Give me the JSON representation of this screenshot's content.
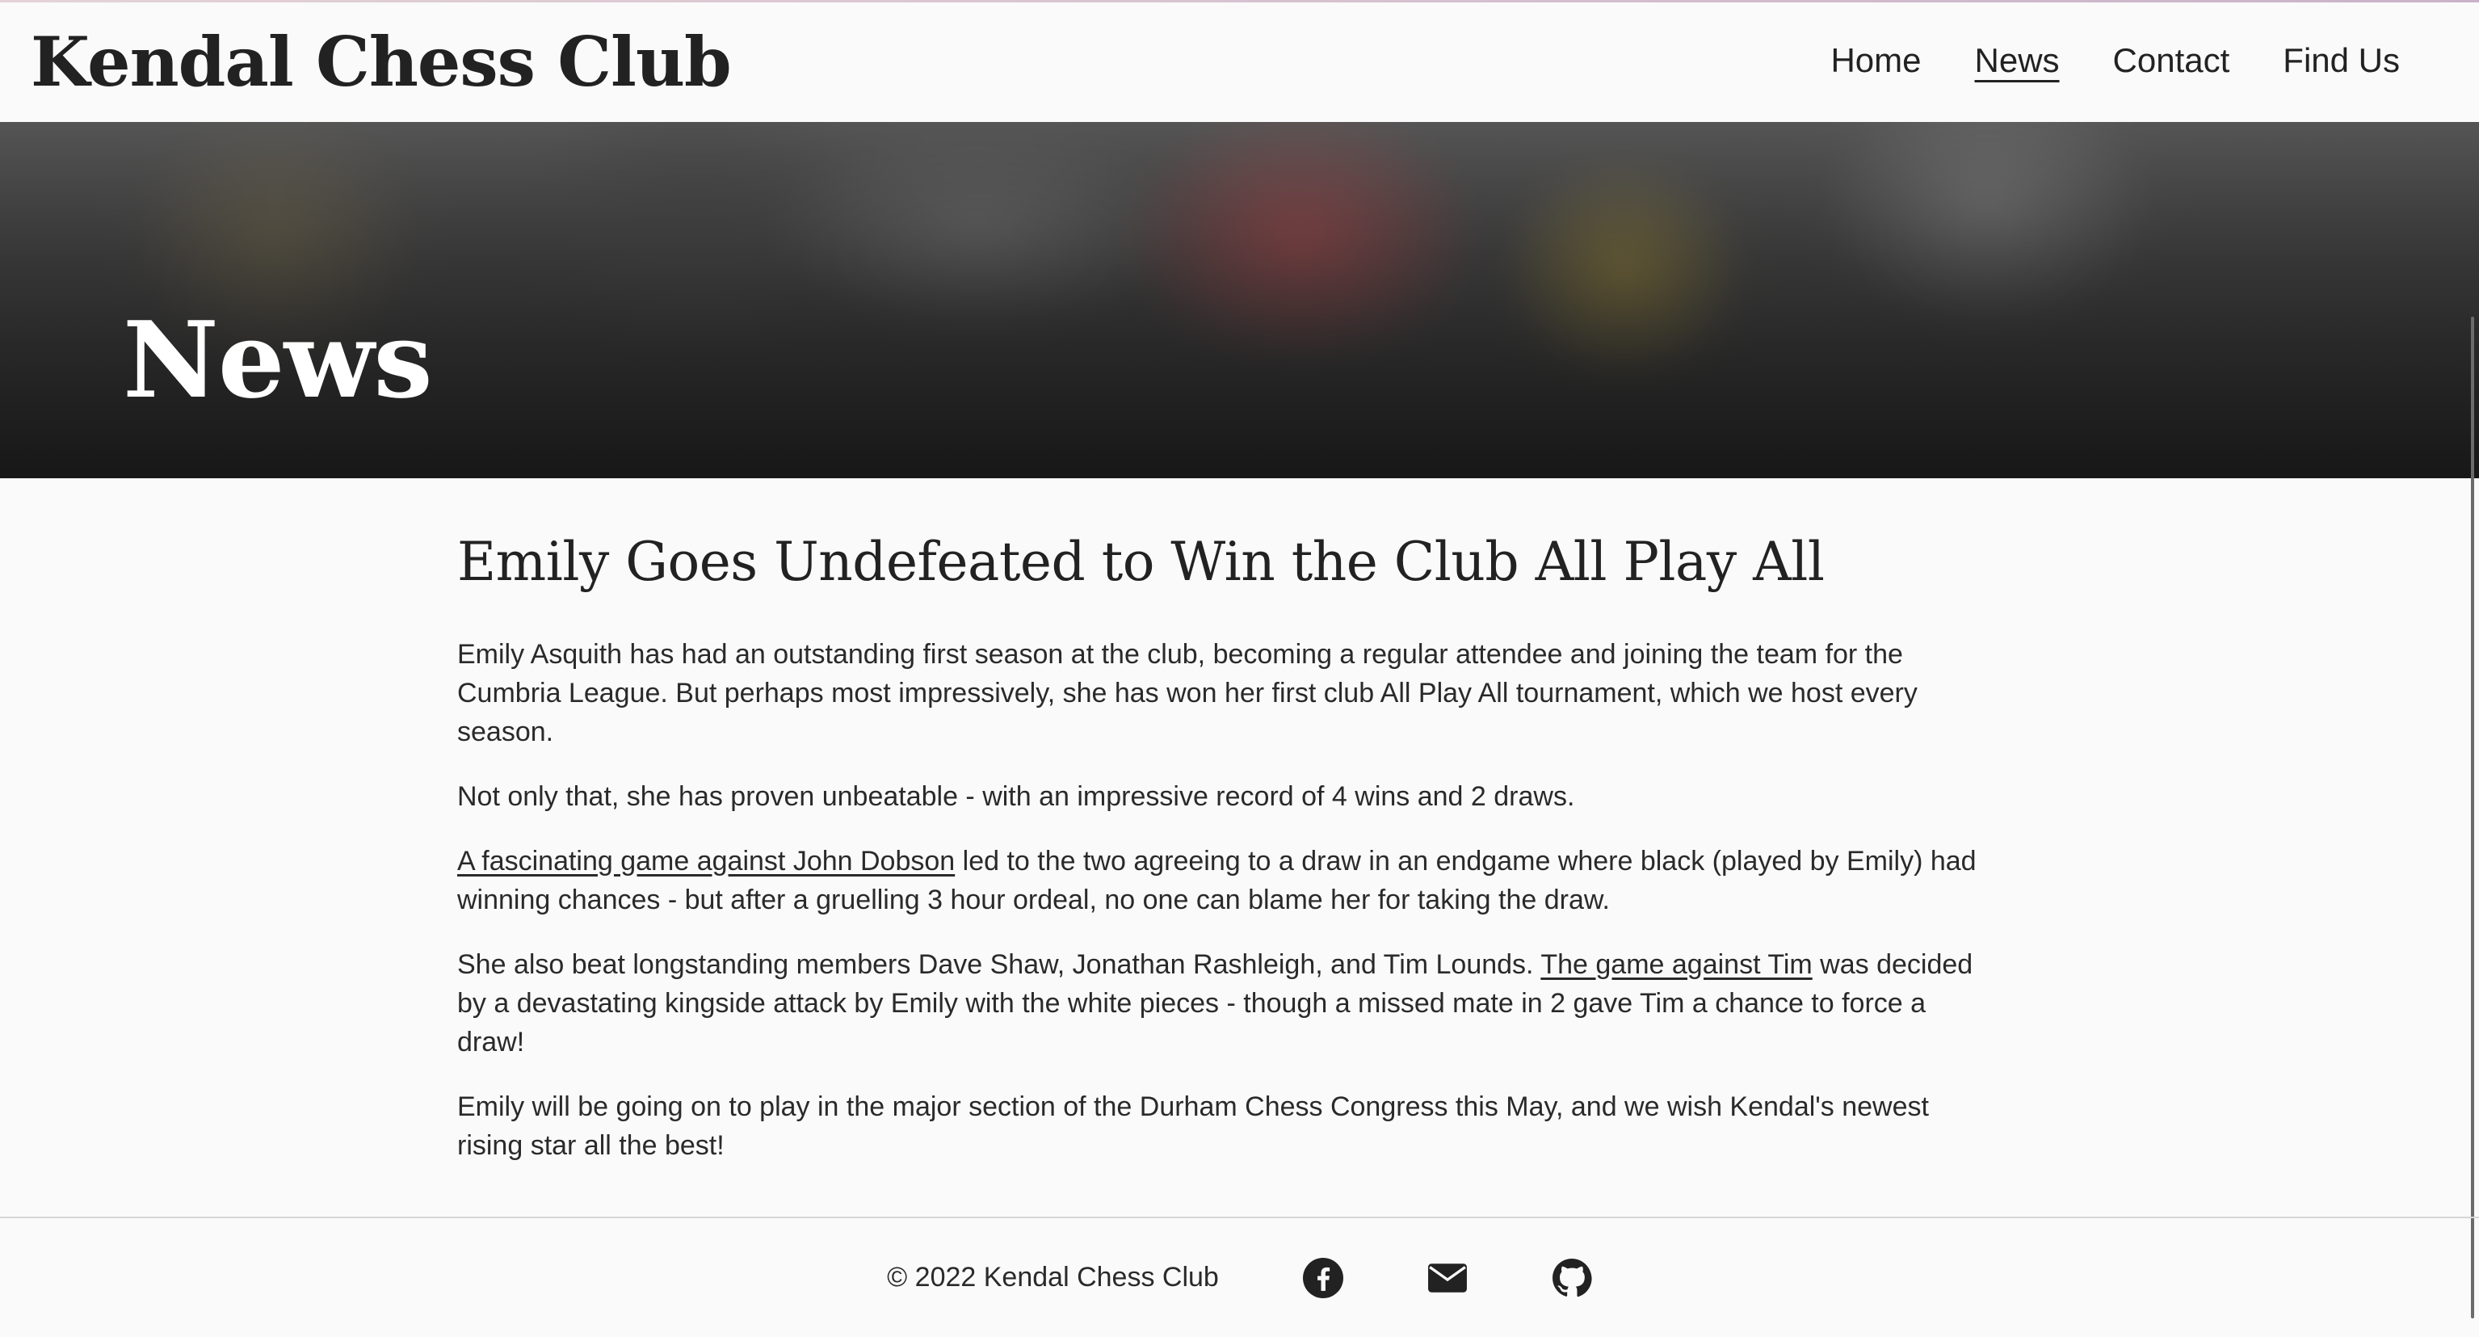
{
  "header": {
    "site_title": "Kendal Chess Club",
    "nav": [
      {
        "label": "Home",
        "active": false
      },
      {
        "label": "News",
        "active": true
      },
      {
        "label": "Contact",
        "active": false
      },
      {
        "label": "Find Us",
        "active": false
      }
    ]
  },
  "hero": {
    "title": "News"
  },
  "article": {
    "headline": "Emily Goes Undefeated to Win the Club All Play All",
    "p1": "Emily Asquith has had an outstanding first season at the club, becoming a regular attendee and joining the team for the Cumbria League. But perhaps most impressively, she has won her first club All Play All tournament, which we host every season.",
    "p2": "Not only that, she has proven unbeatable - with an impressive record of 4 wins and 2 draws.",
    "p3_link": "A fascinating game against John Dobson",
    "p3_rest": " led to the two agreeing to a draw in an endgame where black (played by Emily) had winning chances - but after a gruelling 3 hour ordeal, no one can blame her for taking the draw.",
    "p4_start": "She also beat longstanding members Dave Shaw, Jonathan Rashleigh, and Tim Lounds. ",
    "p4_link": "The game against Tim",
    "p4_rest": " was decided by a devastating kingside attack by Emily with the white pieces - though a missed mate in 2 gave Tim a chance to force a draw!",
    "p5": "Emily will be going on to play in the major section of the Durham Chess Congress this May, and we wish Kendal's newest rising star all the best!"
  },
  "footer": {
    "copyright": "© 2022 Kendal Chess Club",
    "icons": [
      "facebook-icon",
      "envelope-icon",
      "github-icon"
    ]
  },
  "colors": {
    "background": "#fafafa",
    "text": "#222222",
    "hero_text": "#ffffff"
  }
}
